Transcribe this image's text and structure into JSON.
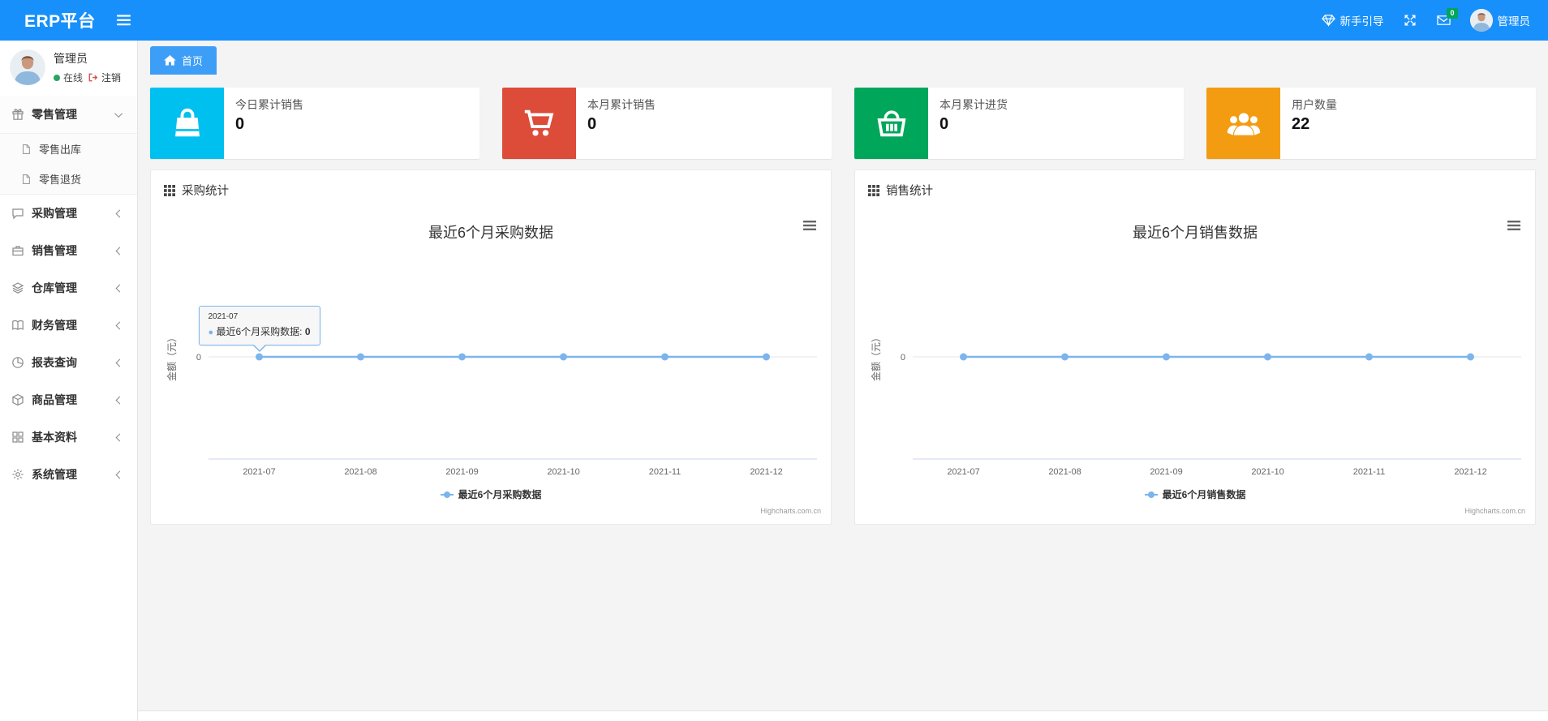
{
  "colors": {
    "navbar": "#1890fb",
    "tab": "#3d9ef7",
    "chart_line": "#7cb5ec",
    "badge_green": "#00a65a"
  },
  "navbar": {
    "brand": "ERP平台",
    "guide_label": "新手引导",
    "messages_badge": "0",
    "username": "管理员"
  },
  "sidebar": {
    "user": {
      "name": "管理员",
      "status": "在线",
      "logout": "注销"
    },
    "menu": [
      {
        "key": "retail",
        "label": "零售管理",
        "icon": "gift-icon",
        "expanded": true,
        "children": [
          {
            "key": "retail-outbound",
            "label": "零售出库",
            "icon": "file-icon"
          },
          {
            "key": "retail-return",
            "label": "零售退货",
            "icon": "file-icon"
          }
        ]
      },
      {
        "key": "purchase",
        "label": "采购管理",
        "icon": "comment-icon"
      },
      {
        "key": "sales",
        "label": "销售管理",
        "icon": "briefcase-icon"
      },
      {
        "key": "warehouse",
        "label": "仓库管理",
        "icon": "layers-icon"
      },
      {
        "key": "finance",
        "label": "财务管理",
        "icon": "book-icon"
      },
      {
        "key": "reports",
        "label": "报表查询",
        "icon": "pie-icon"
      },
      {
        "key": "goods",
        "label": "商品管理",
        "icon": "box-icon"
      },
      {
        "key": "basic",
        "label": "基本资料",
        "icon": "grid-icon"
      },
      {
        "key": "system",
        "label": "系统管理",
        "icon": "gear-icon"
      }
    ]
  },
  "breadcrumb": {
    "home": "首页"
  },
  "stats": [
    {
      "key": "today-sales",
      "label": "今日累计销售",
      "value": "0",
      "color": "#00c0ef",
      "icon": "shopping-bag-icon"
    },
    {
      "key": "month-sales",
      "label": "本月累计销售",
      "value": "0",
      "color": "#dd4b39",
      "icon": "cart-icon"
    },
    {
      "key": "month-purchase",
      "label": "本月累计进货",
      "value": "0",
      "color": "#00a65a",
      "icon": "basket-icon"
    },
    {
      "key": "user-count",
      "label": "用户数量",
      "value": "22",
      "color": "#f39c12",
      "icon": "users-icon"
    }
  ],
  "panels": [
    {
      "header": "采购统计"
    },
    {
      "header": "销售统计"
    }
  ],
  "chart_data": [
    {
      "type": "line",
      "title": "最近6个月采购数据",
      "categories": [
        "2021-07",
        "2021-08",
        "2021-09",
        "2021-10",
        "2021-11",
        "2021-12"
      ],
      "series": [
        {
          "name": "最近6个月采购数据",
          "values": [
            0,
            0,
            0,
            0,
            0,
            0
          ]
        }
      ],
      "xlabel": "",
      "ylabel": "金额（元）",
      "ylim": [
        -1,
        1
      ],
      "yticks": [
        "0"
      ],
      "grid": true,
      "legend_position": "bottom",
      "line_color": "#7cb5ec",
      "credits": "Highcharts.com.cn",
      "tooltip": {
        "visible": true,
        "category": "2021-07",
        "series": "最近6个月采购数据",
        "value": "0"
      }
    },
    {
      "type": "line",
      "title": "最近6个月销售数据",
      "categories": [
        "2021-07",
        "2021-08",
        "2021-09",
        "2021-10",
        "2021-11",
        "2021-12"
      ],
      "series": [
        {
          "name": "最近6个月销售数据",
          "values": [
            0,
            0,
            0,
            0,
            0,
            0
          ]
        }
      ],
      "xlabel": "",
      "ylabel": "金额（元）",
      "ylim": [
        -1,
        1
      ],
      "yticks": [
        "0"
      ],
      "grid": true,
      "legend_position": "bottom",
      "line_color": "#7cb5ec",
      "credits": "Highcharts.com.cn",
      "tooltip": {
        "visible": false
      }
    }
  ]
}
